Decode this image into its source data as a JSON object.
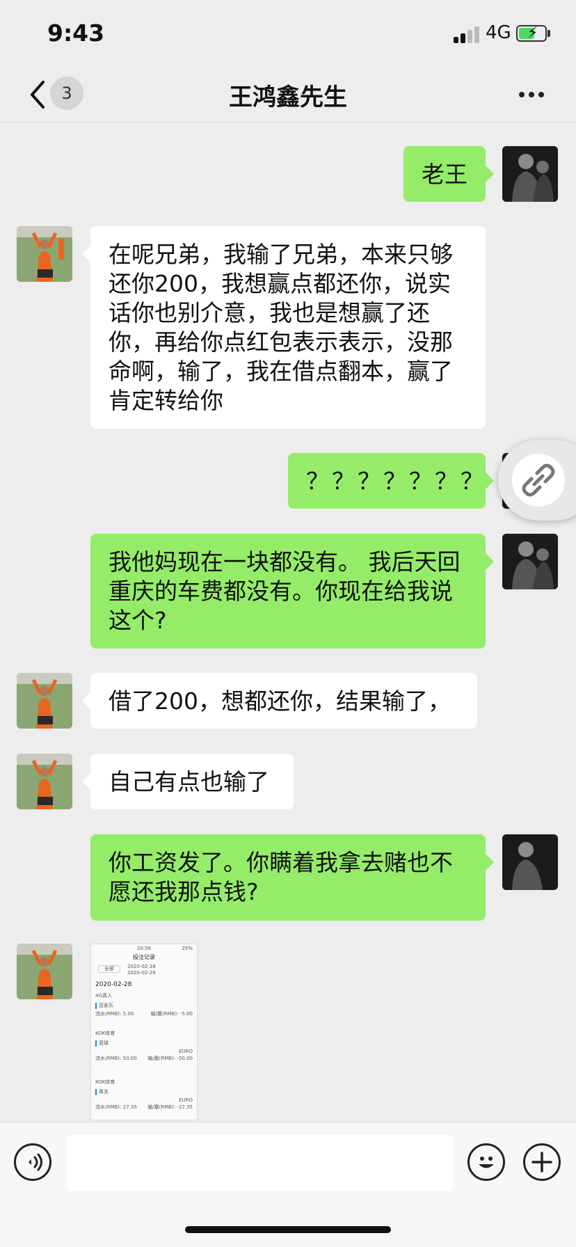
{
  "status_bar": {
    "time": "9:43",
    "network": "4G",
    "battery_icon": "battery-charging-icon",
    "signal_icon": "signal-bars-icon"
  },
  "navbar": {
    "back_icon": "chevron-left-icon",
    "unread_count": "3",
    "title": "王鸿鑫先生",
    "more_icon": "ellipsis-icon"
  },
  "messages": [
    {
      "side": "right",
      "text": "老王"
    },
    {
      "side": "left",
      "text": "在呢兄弟，我输了兄弟，本来只够还你200，我想赢点都还你，说实话你也别介意，我也是想赢了还你，再给你点红包表示表示，没那命啊，输了，我在借点翻本，赢了肯定转给你"
    },
    {
      "side": "right",
      "text": "？？？？？？？"
    },
    {
      "side": "right",
      "text": "我他妈现在一块都没有。 我后天回重庆的车费都没有。你现在给我说这个?"
    },
    {
      "side": "left",
      "text": "借了200，想都还你，结果输了，"
    },
    {
      "side": "left",
      "text": "自己有点也输了"
    },
    {
      "side": "right",
      "text": "你工资发了。你瞒着我拿去赌也不愿还我那点钱?"
    }
  ],
  "image_message": {
    "status": "20:56",
    "battery": "25%",
    "header": "投注记录",
    "filter": "全部",
    "date_from": "2020-02-28",
    "date_to": "2020-02-28",
    "day": "2020-02-28",
    "sections": [
      {
        "platform": "AG真人",
        "game": "百家乐",
        "line1": "流水(RMB): 5.00",
        "line1b": "输/赢(RMB): -5.00"
      },
      {
        "platform": "KOK体育",
        "game": "篮球",
        "line1": "流水(RMB): 50.00",
        "line1b": "输/赢(RMB): -50.00",
        "odds_type": "EURO"
      },
      {
        "platform": "KOK体育",
        "game": "单关",
        "line1": "流水(RMB): 27.35",
        "line1b": "输/赢(RMB): -27.35",
        "odds_type": "EURO"
      }
    ]
  },
  "floating_button": {
    "icon": "link-icon"
  },
  "input_bar": {
    "voice_icon": "voice-icon",
    "emoji_icon": "emoji-icon",
    "plus_icon": "plus-icon",
    "placeholder": ""
  },
  "colors": {
    "background": "#ededed",
    "my_bubble": "#95ec69",
    "friend_bubble": "#ffffff"
  }
}
